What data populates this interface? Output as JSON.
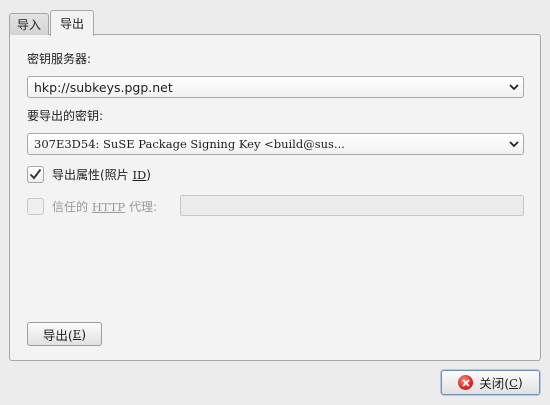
{
  "tabs": [
    {
      "label": "导入"
    },
    {
      "label": "导出"
    }
  ],
  "key_server": {
    "label": "密钥服务器:",
    "value": "hkp://subkeys.pgp.net"
  },
  "export_key": {
    "label": "要导出的密钥:",
    "value": "307E3D54: SuSE Package Signing Key <build@sus..."
  },
  "export_attributes": {
    "label_pre": "导出属性(照片 ",
    "label_mnemonic": "ID",
    "label_post": ")",
    "checked": true
  },
  "http_proxy": {
    "label_pre": "信任的 ",
    "label_mnemonic": "HTTP",
    "label_post": " 代理:",
    "checked": false,
    "enabled": false,
    "value": ""
  },
  "export_button": {
    "label_pre": "导出(",
    "label_mnemonic": "E",
    "label_post": ")"
  },
  "close_button": {
    "label_pre": "关闭(",
    "label_mnemonic": "C",
    "label_post": ")"
  },
  "icons": {
    "dropdown": "chevron-down-icon",
    "check": "check-icon",
    "close": "close-icon"
  }
}
